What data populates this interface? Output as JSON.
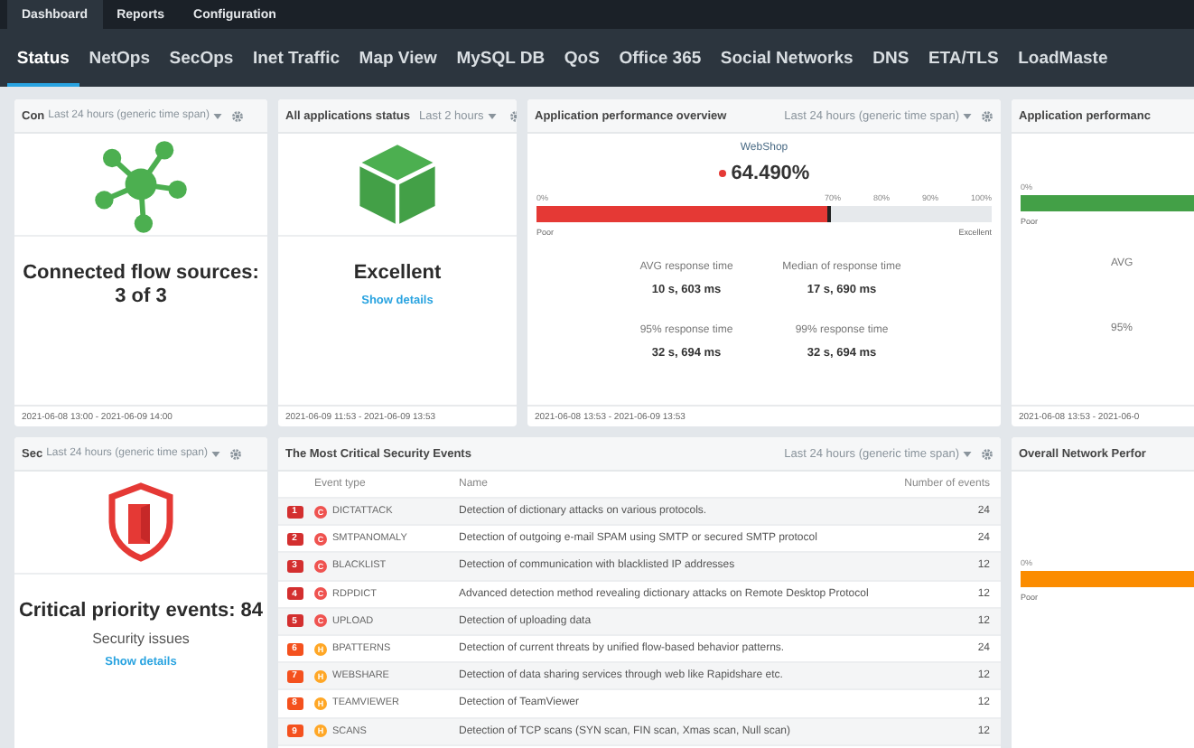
{
  "top_tabs": [
    {
      "label": "Dashboard",
      "selected": true
    },
    {
      "label": "Reports",
      "selected": false
    },
    {
      "label": "Configuration",
      "selected": false
    }
  ],
  "tabs": [
    {
      "label": "Status",
      "selected": true
    },
    {
      "label": "NetOps",
      "selected": false
    },
    {
      "label": "SecOps",
      "selected": false
    },
    {
      "label": "Inet Traffic",
      "selected": false
    },
    {
      "label": "Map View",
      "selected": false
    },
    {
      "label": "MySQL DB",
      "selected": false
    },
    {
      "label": "QoS",
      "selected": false
    },
    {
      "label": "Office 365",
      "selected": false
    },
    {
      "label": "Social Networks",
      "selected": false
    },
    {
      "label": "DNS",
      "selected": false
    },
    {
      "label": "ETA/TLS",
      "selected": false
    },
    {
      "label": "LoadMaste",
      "selected": false
    }
  ],
  "flow_sources": {
    "title": "Con",
    "time_span": "Last 24 hours (generic time span)",
    "headline": [
      "Connected flow sources:",
      "3 of 3"
    ],
    "footer": "2021-06-08 13:00 - 2021-06-09 14:00"
  },
  "applications_status": {
    "title": "All applications status",
    "time_span": "Last 2 hours",
    "headline": "Excellent",
    "link": "Show details",
    "footer": "2021-06-09 11:53 - 2021-06-09 13:53"
  },
  "app_performance": {
    "title": "Application performance overview",
    "time_span": "Last 24 hours (generic time span)",
    "app": "WebShop",
    "score": "64.490%",
    "gauge": {
      "color": "#e53935",
      "level": 0.645,
      "ticks": [
        "0%",
        "70%",
        "80%",
        "90%",
        "100%"
      ],
      "low_label": "Poor",
      "high_label": "Excellent"
    },
    "metrics": [
      {
        "label": "AVG response time",
        "value": "10 s, 603 ms"
      },
      {
        "label": "Median of response time",
        "value": "17 s, 690 ms"
      },
      {
        "label": "95% response time",
        "value": "32 s, 694 ms"
      },
      {
        "label": "99% response time",
        "value": "32 s, 694 ms"
      }
    ],
    "footer": "2021-06-08 13:53 - 2021-06-09 13:53"
  },
  "app_performance_2": {
    "title": "Application performanc",
    "gauge": {
      "color": "#43a047",
      "level": 1,
      "ticks": [
        "0%"
      ],
      "low_label": "Poor"
    },
    "metrics": [
      "AVG",
      "95%"
    ],
    "footer": "2021-06-08 13:53 - 2021-06-0"
  },
  "security": {
    "title": "Sec",
    "time_span": "Last 24 hours (generic time span)",
    "headline": "Critical priority events: 84",
    "subtitle": "Security issues",
    "link": "Show details"
  },
  "events": {
    "title": "The Most Critical Security Events",
    "time_span": "Last 24 hours (generic time span)",
    "columns": [
      "Event type",
      "Name",
      "Number of events"
    ],
    "rows": [
      {
        "rank": "1",
        "critical": true,
        "letter": "C",
        "type": "DICTATTACK",
        "name": "Detection of dictionary attacks on various protocols.",
        "count": "24"
      },
      {
        "rank": "2",
        "critical": true,
        "letter": "C",
        "type": "SMTPANOMALY",
        "name": "Detection of outgoing e-mail SPAM using SMTP or secured SMTP protocol",
        "count": "24"
      },
      {
        "rank": "3",
        "critical": true,
        "letter": "C",
        "type": "BLACKLIST",
        "name": "Detection of communication with blacklisted IP addresses",
        "count": "12"
      },
      {
        "rank": "4",
        "critical": true,
        "letter": "C",
        "type": "RDPDICT",
        "name": "Advanced detection method revealing dictionary attacks on Remote Desktop Protocol",
        "count": "12"
      },
      {
        "rank": "5",
        "critical": true,
        "letter": "C",
        "type": "UPLOAD",
        "name": "Detection of uploading data",
        "count": "12"
      },
      {
        "rank": "6",
        "critical": false,
        "letter": "H",
        "type": "BPATTERNS",
        "name": "Detection of current threats by unified flow-based behavior patterns.",
        "count": "24"
      },
      {
        "rank": "7",
        "critical": false,
        "letter": "H",
        "type": "WEBSHARE",
        "name": "Detection of data sharing services through web like Rapidshare etc.",
        "count": "12"
      },
      {
        "rank": "8",
        "critical": false,
        "letter": "H",
        "type": "TEAMVIEWER",
        "name": "Detection of TeamViewer",
        "count": "12"
      },
      {
        "rank": "9",
        "critical": false,
        "letter": "H",
        "type": "SCANS",
        "name": "Detection of TCP scans (SYN scan, FIN scan, Xmas scan, Null scan)",
        "count": "12"
      }
    ]
  },
  "network_performance": {
    "title": "Overall Network Perfor",
    "gauge": {
      "color": "#fb8c00",
      "level": 1,
      "ticks": [
        "0%"
      ],
      "low_label": "Poor"
    }
  }
}
